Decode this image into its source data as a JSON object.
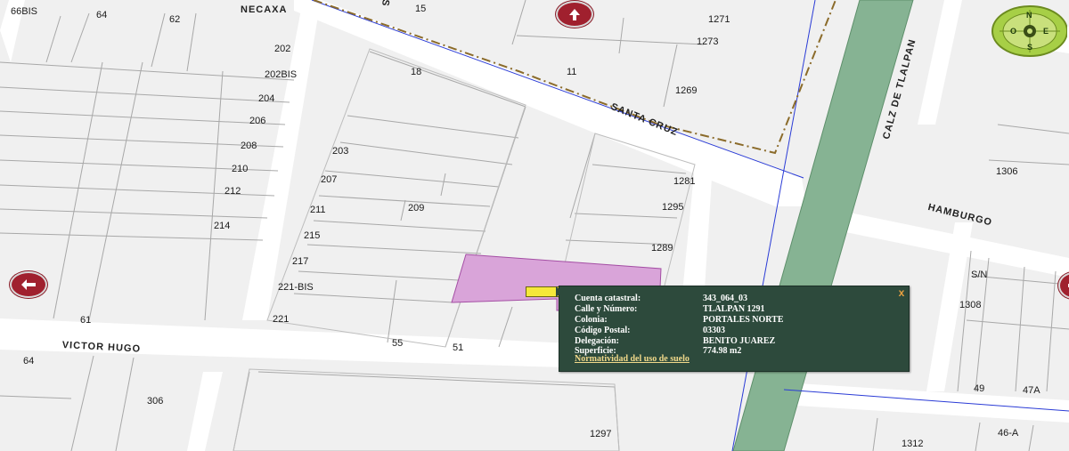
{
  "streets": {
    "necaxa": "NECAXA",
    "santa_cruz": "SANTA CRUZ",
    "s_top": "S",
    "calz_tlalpan": "CALZ DE TLALPAN",
    "hamburgo": "HAMBURGO",
    "victor_hugo": "VICTOR HUGO"
  },
  "lot_numbers": {
    "n66bis": "66BIS",
    "n64a": "64",
    "n62": "62",
    "n15": "15",
    "n1271": "1271",
    "n1273": "1273",
    "n202": "202",
    "n202bis": "202BIS",
    "n18": "18",
    "n11": "11",
    "n1269": "1269",
    "n204": "204",
    "n206": "206",
    "n208": "208",
    "n210": "210",
    "n212": "212",
    "n214": "214",
    "n203": "203",
    "n207": "207",
    "n211": "211",
    "n209": "209",
    "n215": "215",
    "n217": "217",
    "n221bis": "221-BIS",
    "n221": "221",
    "n1281": "1281",
    "n1295": "1295",
    "n1289": "1289",
    "n1306": "1306",
    "nsn": "S/N",
    "n1308": "1308",
    "n61": "61",
    "n55": "55",
    "n51": "51",
    "n64b": "64",
    "n306": "306",
    "n1297": "1297",
    "n49": "49",
    "n47a": "47A",
    "n1312": "1312",
    "n46a": "46-A"
  },
  "compass": {
    "north": "N",
    "south": "S",
    "east": "E",
    "west": "O"
  },
  "popup": {
    "rows": [
      {
        "label": "Cuenta catastral:",
        "value": "343_064_03"
      },
      {
        "label": "Calle y Número:",
        "value": "TLALPAN 1291"
      },
      {
        "label": "Colonia:",
        "value": "PORTALES NORTE"
      },
      {
        "label": "Código Postal:",
        "value": "03303"
      },
      {
        "label": "Delegación:",
        "value": "BENITO JUAREZ"
      },
      {
        "label": "Superficie:",
        "value": "774.98 m2"
      }
    ],
    "link": "Normatividad del uso de suelo",
    "close": "x"
  },
  "colors": {
    "road": "#ffffff",
    "block": "#efefef",
    "lot_line": "#a8a8a8",
    "avenue": "#86b393",
    "selected_lot": "#d9a4d9",
    "popup_bg": "#2d4a3c",
    "nav_arrow": "#a0202e"
  }
}
